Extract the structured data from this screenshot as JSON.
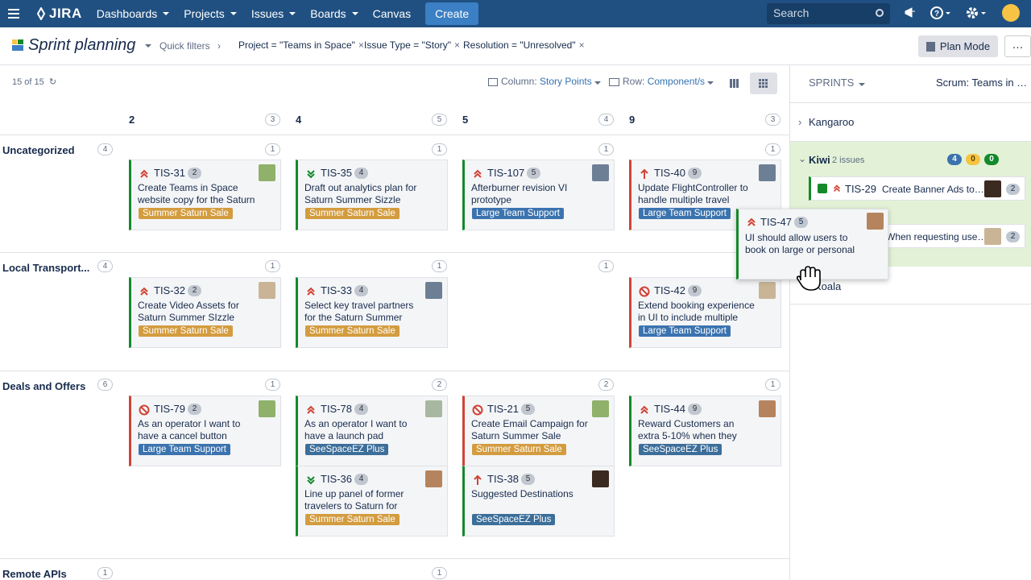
{
  "nav": {
    "logo": "JIRA",
    "items": [
      "Dashboards",
      "Projects",
      "Issues",
      "Boards",
      "Canvas"
    ],
    "create": "Create",
    "search_placeholder": "Search"
  },
  "header": {
    "title": "Sprint planning",
    "quick_filters": "Quick filters",
    "filters": [
      "Project = \"Teams in Space\"",
      "Issue Type = \"Story\"",
      "Resolution = \"Unresolved\""
    ],
    "plan_mode": "Plan Mode",
    "more": "..."
  },
  "toolbar": {
    "count": "15 of 15",
    "column_label": "Column:",
    "column_value": "Story Points",
    "row_label": "Row:",
    "row_value": "Component/s"
  },
  "columns": [
    {
      "label": "2",
      "count": "3"
    },
    {
      "label": "4",
      "count": "5"
    },
    {
      "label": "5",
      "count": "4"
    },
    {
      "label": "9",
      "count": "3"
    }
  ],
  "rows": [
    {
      "label": "Uncategorized",
      "count": "4",
      "cell_counts": [
        "1",
        "1",
        "1",
        "1"
      ]
    },
    {
      "label": "Local Transport...",
      "count": "4",
      "cell_counts": [
        "1",
        "1",
        "1"
      ]
    },
    {
      "label": "Deals and Offers",
      "count": "6",
      "cell_counts": [
        "1",
        "2",
        "2",
        "1"
      ]
    },
    {
      "label": "Remote APIs",
      "count": "1",
      "cell_counts": [
        "1"
      ]
    }
  ],
  "cards": [
    {
      "key": "TIS-31",
      "points": "2",
      "summary": "Create Teams in Space website copy for the Saturn",
      "epic": "Summer Saturn Sale"
    },
    {
      "key": "TIS-35",
      "points": "4",
      "summary": "Draft out analytics plan for Saturn Summer Sizzle website",
      "epic": "Summer Saturn Sale"
    },
    {
      "key": "TIS-107",
      "points": "5",
      "summary": "Afterburner revision VI prototype",
      "epic": "Large Team Support"
    },
    {
      "key": "TIS-40",
      "points": "9",
      "summary": "Update FlightController to handle multiple travel",
      "epic": "Large Team Support"
    },
    {
      "key": "TIS-32",
      "points": "2",
      "summary": "Create Video Assets for Saturn Summer SIzzle",
      "epic": "Summer Saturn Sale"
    },
    {
      "key": "TIS-33",
      "points": "4",
      "summary": "Select key travel partners for the Saturn Summer",
      "epic": "Summer Saturn Sale"
    },
    {
      "key": "TIS-42",
      "points": "9",
      "summary": "Extend booking experience in UI to include multiple",
      "epic": "Large Team Support"
    },
    {
      "key": "TIS-79",
      "points": "2",
      "summary": "As an operator I want to have a cancel button",
      "epic": "Large Team Support"
    },
    {
      "key": "TIS-78",
      "points": "4",
      "summary": "As an operator I want to have a launch pad",
      "epic": "SeeSpaceEZ Plus"
    },
    {
      "key": "TIS-21",
      "points": "5",
      "summary": "Create Email Campaign for Saturn Summer Sale",
      "epic": "Summer Saturn Sale"
    },
    {
      "key": "TIS-44",
      "points": "9",
      "summary": "Reward Customers an extra 5-10% when they book a",
      "epic": "SeeSpaceEZ Plus"
    },
    {
      "key": "TIS-36",
      "points": "4",
      "summary": "Line up panel of former travelers to Saturn for",
      "epic": "Summer Saturn Sale"
    },
    {
      "key": "TIS-38",
      "points": "5",
      "summary": "Suggested Destinations",
      "epic": "SeeSpaceEZ Plus"
    }
  ],
  "drag_card": {
    "key": "TIS-47",
    "points": "5",
    "summary": "UI should allow users to book on large or personal"
  },
  "sidebar": {
    "sprints_label": "SPRINTS",
    "scrum_label": "Scrum: Teams in …",
    "sprint1": "Kangaroo",
    "kiwi_name": "Kiwi",
    "kiwi_issues": "2 issues",
    "kiwi_badges": [
      "4",
      "0",
      "0"
    ],
    "kiwi_item1_key": "TIS-29",
    "kiwi_item1_summary": "Create Banner Ads to…",
    "kiwi_item1_pts": "2",
    "kiwi_item2_summary": "When requesting use…",
    "kiwi_item2_pts": "2",
    "sprint3": "Koala"
  },
  "colors": {
    "nav": "#205081",
    "green": "#14892c",
    "red": "#d04437",
    "orange_epic": "#d39c3f",
    "blue_epic": "#3b73af"
  }
}
